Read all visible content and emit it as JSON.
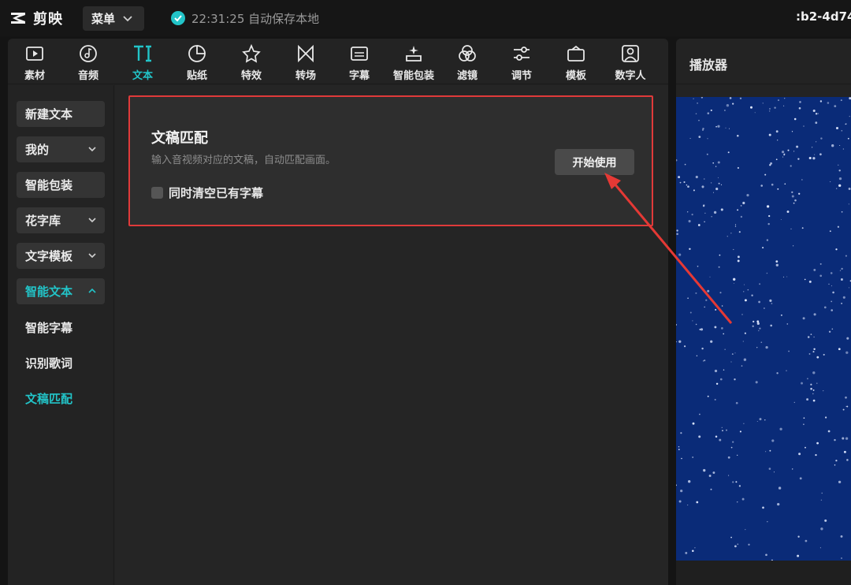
{
  "app": {
    "name": "剪映"
  },
  "topbar": {
    "menu_label": "菜单",
    "save_status": "22:31:25 自动保存本地",
    "project_id": ":b2-4d74"
  },
  "toolbar": {
    "tools": [
      {
        "label": "素材",
        "icon": "media-icon"
      },
      {
        "label": "音频",
        "icon": "audio-icon"
      },
      {
        "label": "文本",
        "icon": "text-icon",
        "active": true
      },
      {
        "label": "贴纸",
        "icon": "sticker-icon"
      },
      {
        "label": "特效",
        "icon": "effects-icon"
      },
      {
        "label": "转场",
        "icon": "transition-icon"
      },
      {
        "label": "字幕",
        "icon": "subtitle-icon"
      },
      {
        "label": "智能包装",
        "icon": "smart-pack-icon"
      },
      {
        "label": "滤镜",
        "icon": "filter-icon"
      },
      {
        "label": "调节",
        "icon": "adjust-icon"
      },
      {
        "label": "模板",
        "icon": "template-icon"
      },
      {
        "label": "数字人",
        "icon": "digital-human-icon"
      }
    ]
  },
  "sidebar": {
    "items": [
      {
        "label": "新建文本"
      },
      {
        "label": "我的"
      },
      {
        "label": "智能包装"
      },
      {
        "label": "花字库"
      },
      {
        "label": "文字模板"
      },
      {
        "label": "智能文本",
        "active": true
      },
      {
        "label": "智能字幕"
      },
      {
        "label": "识别歌词"
      },
      {
        "label": "文稿匹配",
        "active": true
      }
    ]
  },
  "card": {
    "title": "文稿匹配",
    "description": "输入音视频对应的文稿，自动匹配画面。",
    "start_button": "开始使用",
    "checkbox_label": "同时清空已有字幕",
    "checkbox_checked": false
  },
  "player": {
    "title": "播放器"
  },
  "colors": {
    "accent": "#22c4c8",
    "highlight_border": "#e03a3a",
    "video_background": "#0a2b78"
  }
}
